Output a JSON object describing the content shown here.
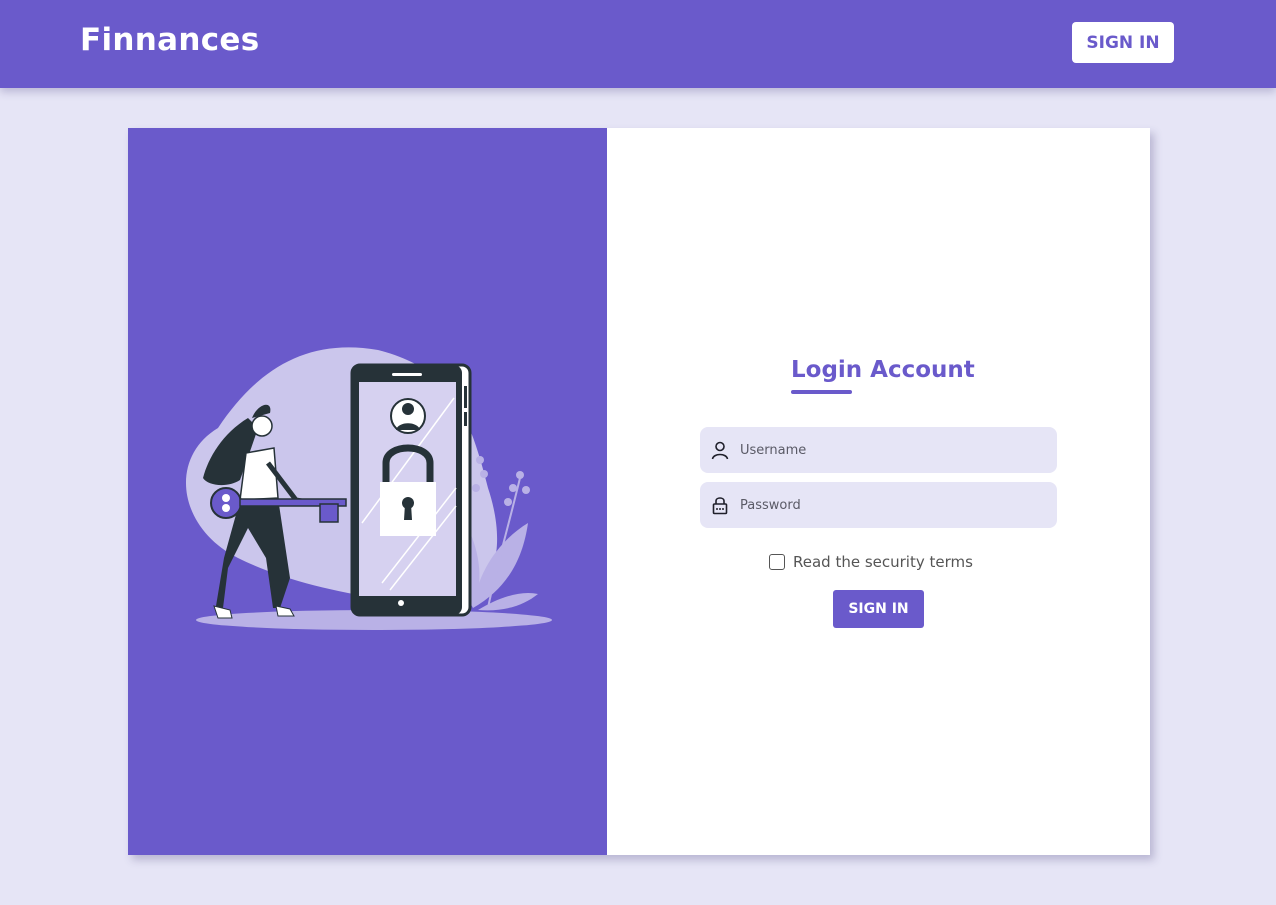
{
  "header": {
    "brand": "Finnances",
    "signin_label": "SIGN IN"
  },
  "login": {
    "title": "Login Account",
    "username_placeholder": "Username",
    "password_placeholder": "Password",
    "terms_label": "Read the security terms",
    "terms_checked": false,
    "signin_label": "SIGN IN"
  },
  "icons": {
    "username": "user-icon",
    "password": "lock-icon"
  },
  "colors": {
    "accent": "#6a5acb",
    "page_background": "#e6e5f6",
    "field_background": "#e6e5f6",
    "illustration_dark": "#263238"
  }
}
